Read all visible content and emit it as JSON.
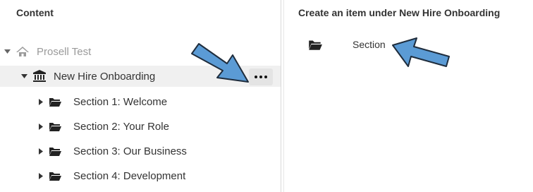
{
  "left_panel": {
    "title": "Content",
    "tree": [
      {
        "label": "Prosell Test",
        "icon": "home-icon",
        "expanded": true,
        "muted": true
      },
      {
        "label": "New Hire Onboarding",
        "icon": "institution-icon",
        "expanded": true,
        "selected": true
      },
      {
        "label": "Section 1: Welcome",
        "icon": "folder-icon",
        "expanded": false
      },
      {
        "label": "Section 2: Your Role",
        "icon": "folder-icon",
        "expanded": false
      },
      {
        "label": "Section 3: Our Business",
        "icon": "folder-icon",
        "expanded": false
      },
      {
        "label": "Section 4: Development",
        "icon": "folder-icon",
        "expanded": false
      }
    ],
    "more_button_icon": "more-horizontal-icon"
  },
  "right_panel": {
    "title": "Create an item under New Hire Onboarding",
    "options": [
      {
        "label": "Section",
        "icon": "folder-icon"
      }
    ]
  },
  "annotations": {
    "arrow_color": "#5b9bd5",
    "arrow_outline": "#1f2d3d"
  }
}
